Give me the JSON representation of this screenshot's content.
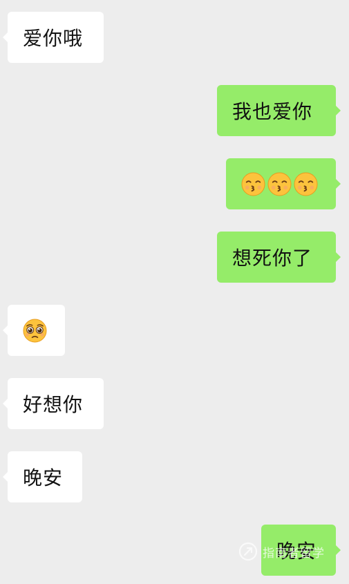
{
  "messages": [
    {
      "sender": "other",
      "text": "爱你哦"
    },
    {
      "sender": "me",
      "text": "我也爱你"
    },
    {
      "sender": "me",
      "emojis": [
        "kissing-face-icon",
        "kissing-face-icon",
        "kissing-face-icon"
      ]
    },
    {
      "sender": "me",
      "text": "想死你了"
    },
    {
      "sender": "other",
      "emojis": [
        "pleading-face-icon"
      ]
    },
    {
      "sender": "other",
      "text": "好想你"
    },
    {
      "sender": "other",
      "text": "晚安"
    },
    {
      "sender": "me",
      "text": "晚安"
    }
  ],
  "watermark": {
    "text": "指南者留学"
  },
  "colors": {
    "background": "#ededed",
    "incoming_bubble": "#ffffff",
    "outgoing_bubble": "#95ec69",
    "text": "#111111"
  }
}
